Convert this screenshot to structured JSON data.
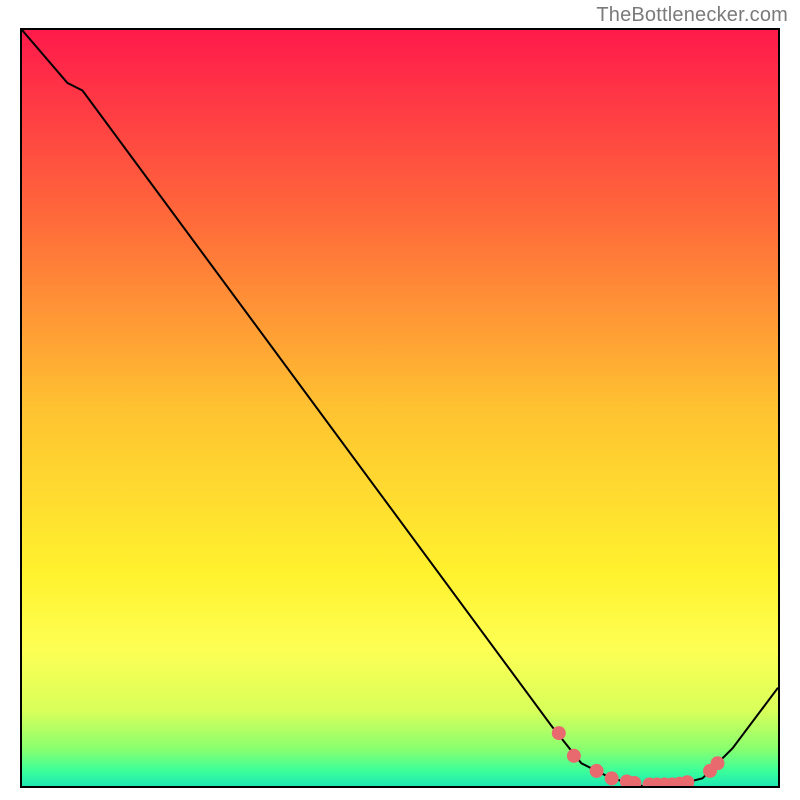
{
  "attribution": "TheBottlenecker.com",
  "chart_data": {
    "type": "line",
    "title": "",
    "xlabel": "",
    "ylabel": "",
    "xlim": [
      0,
      100
    ],
    "ylim": [
      0,
      100
    ],
    "curve": {
      "name": "bottleneck-curve",
      "x": [
        0,
        6,
        8,
        70,
        74,
        78,
        82,
        86,
        90,
        94,
        100
      ],
      "y": [
        100,
        93,
        92,
        8,
        3,
        1,
        0,
        0,
        1,
        5,
        13
      ]
    },
    "markers": {
      "name": "highlight-dots",
      "x": [
        71,
        73,
        76,
        78,
        80,
        81,
        83,
        84,
        85,
        86,
        87,
        88,
        91,
        92
      ],
      "y": [
        7,
        4,
        2,
        1,
        0.6,
        0.4,
        0.2,
        0.2,
        0.2,
        0.2,
        0.3,
        0.5,
        2,
        3
      ]
    },
    "background_gradient": {
      "stops": [
        {
          "offset": 0.0,
          "color": "#ff1a4b"
        },
        {
          "offset": 0.25,
          "color": "#ff6a3a"
        },
        {
          "offset": 0.5,
          "color": "#ffc231"
        },
        {
          "offset": 0.72,
          "color": "#fff22e"
        },
        {
          "offset": 0.82,
          "color": "#fdff54"
        },
        {
          "offset": 0.9,
          "color": "#d9ff5a"
        },
        {
          "offset": 0.95,
          "color": "#8bff6e"
        },
        {
          "offset": 0.98,
          "color": "#3cff9a"
        },
        {
          "offset": 1.0,
          "color": "#1de8b2"
        }
      ]
    },
    "marker_color": "#e86a6f",
    "curve_color": "#000000"
  }
}
